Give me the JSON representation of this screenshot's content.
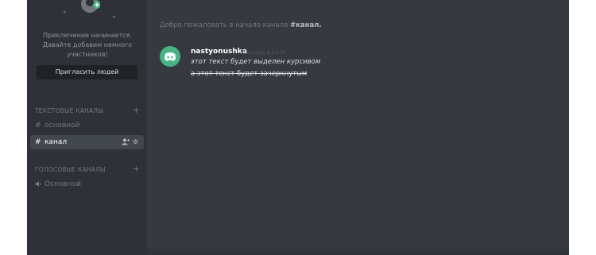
{
  "sidebar": {
    "welcome_lines": [
      "Приключение начинается.",
      "Давайте добавим немного",
      "участников!"
    ],
    "invite_button": "Пригласить людей",
    "text_category": "ТЕКСТОВЫЕ КАНАЛЫ",
    "text_channels": [
      {
        "name": "основной",
        "active": false
      },
      {
        "name": "канал",
        "active": true
      }
    ],
    "voice_category": "ГОЛОСОВЫЕ КАНАЛЫ",
    "voice_channels": [
      {
        "name": "Основной"
      }
    ]
  },
  "main": {
    "intro_prefix": "Добро пожаловать в начало канала ",
    "intro_channel": "#канал.",
    "message": {
      "author": "nastyonushka",
      "time": "Сегодня в 12:00",
      "lines": [
        "этот текст будет выделен курсивом",
        "а этот текст будет зачеркнутым"
      ]
    }
  },
  "colors": {
    "background": "#36393f",
    "sidebar": "#2f3136",
    "accent_green": "#43b581",
    "active_channel": "#42464d"
  },
  "icons": [
    "user-add-icon",
    "add-user-icon",
    "gear-icon",
    "hash-icon",
    "speaker-icon",
    "plus-icon",
    "discord-logo-icon"
  ]
}
